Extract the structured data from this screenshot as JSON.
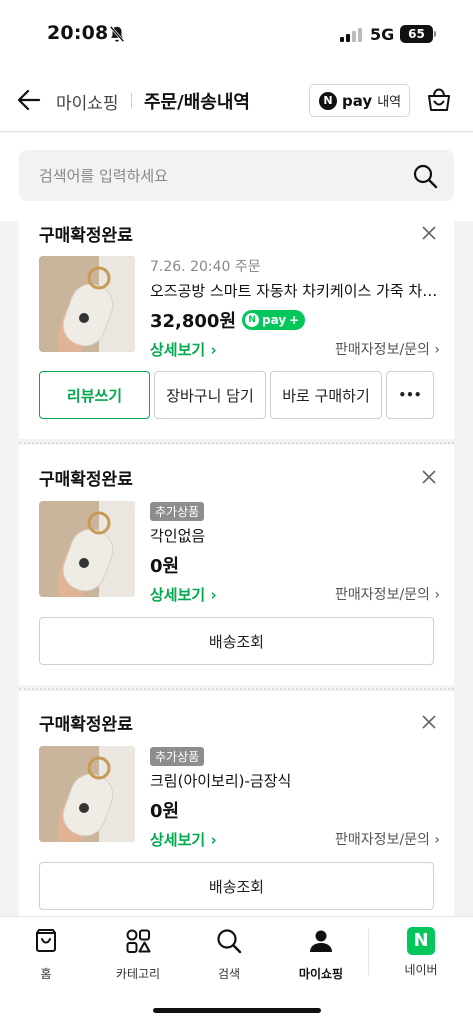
{
  "status_bar": {
    "time": "20:08",
    "network": "5G",
    "battery": "65"
  },
  "header": {
    "breadcrumb": "마이쇼핑",
    "title": "주문/배송내역",
    "npay_logo": "N",
    "npay_pay": "pay",
    "npay_history": "내역"
  },
  "search": {
    "placeholder": "검색어를 입력하세요"
  },
  "orders": [
    {
      "status": "구매확정완료",
      "date": "7.26. 20:40 주문",
      "name": "오즈공방 스마트 자동차 차키케이스 가죽 차키 커버",
      "price": "32,800원",
      "npay_badge": "pay",
      "detail": "상세보기",
      "seller": "판매자정보/문의",
      "buttons": [
        "리뷰쓰기",
        "장바구니 담기",
        "바로 구매하기",
        "•••"
      ]
    },
    {
      "status": "구매확정완료",
      "tag": "추가상품",
      "name": "각인없음",
      "price": "0원",
      "detail": "상세보기",
      "seller": "판매자정보/문의",
      "track": "배송조회"
    },
    {
      "status": "구매확정완료",
      "tag": "추가상품",
      "name": "크림(아이보리)-금장식",
      "price": "0원",
      "detail": "상세보기",
      "seller": "판매자정보/문의",
      "track": "배송조회"
    }
  ],
  "bottom_nav": [
    {
      "label": "홈",
      "icon": "home-icon"
    },
    {
      "label": "카테고리",
      "icon": "category-icon"
    },
    {
      "label": "검색",
      "icon": "search-icon"
    },
    {
      "label": "마이쇼핑",
      "icon": "profile-icon",
      "active": true
    },
    {
      "label": "네이버",
      "icon": "naver-icon"
    }
  ],
  "colors": {
    "accent": "#03c75a",
    "link_green": "#03a94e",
    "background": "#f2f3f5"
  }
}
